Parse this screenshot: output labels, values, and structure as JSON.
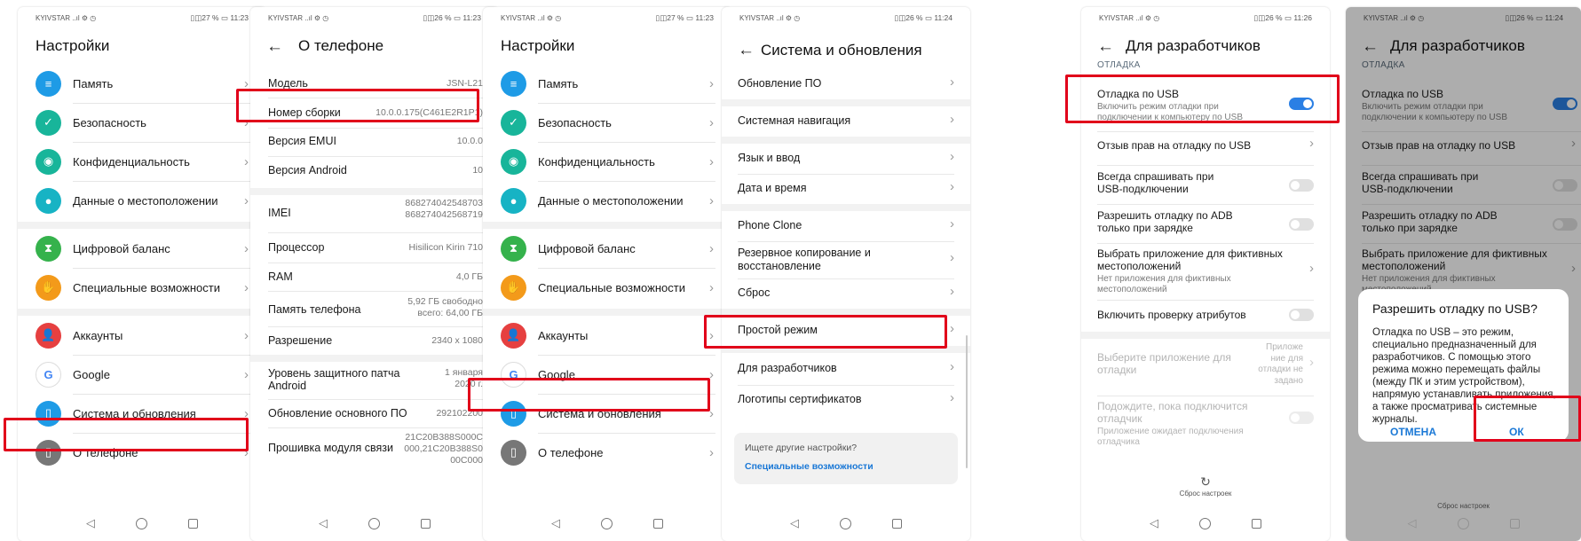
{
  "status": {
    "p1": {
      "carrier": "KYIVSTAR ..ıl ⚙ ◷",
      "right": "▯◫27 % ▭ 11:23"
    },
    "p2": {
      "carrier": "KYIVSTAR ..ıl ⚙ ◷",
      "right": "▯◫26 % ▭ 11:23"
    },
    "p3": {
      "carrier": "KYIVSTAR ..ıl ⚙ ◷",
      "right": "▯◫27 % ▭ 11:23"
    },
    "p4": {
      "carrier": "KYIVSTAR ..ıl ⚙ ◷",
      "right": "▯◫26 % ▭ 11:24"
    },
    "p5": {
      "carrier": "KYIVSTAR ..ıl ⚙ ◷",
      "right": "▯◫26 % ▭ 11:26"
    },
    "p6": {
      "carrier": "KYIVSTAR ..ıl ⚙ ◷",
      "right": "▯◫26 % ▭ 11:24"
    }
  },
  "settings": {
    "title": "Настройки",
    "items": [
      {
        "label": "Память",
        "icon": "storage-icon",
        "color": "#1e9be6"
      },
      {
        "label": "Безопасность",
        "icon": "shield-icon",
        "color": "#18b59a"
      },
      {
        "label": "Конфиденциальность",
        "icon": "privacy-icon",
        "color": "#18b59a"
      },
      {
        "label": "Данные о местоположении",
        "icon": "location-icon",
        "color": "#17b3c4"
      },
      {
        "label": "Цифровой баланс",
        "icon": "hourglass-icon",
        "color": "#35b24c"
      },
      {
        "label": "Специальные возможности",
        "icon": "hand-icon",
        "color": "#f39a1a"
      },
      {
        "label": "Аккаунты",
        "icon": "account-icon",
        "color": "#e64040"
      },
      {
        "label": "Google",
        "icon": "google-icon",
        "color": "#ffffff"
      },
      {
        "label": "Система и обновления",
        "icon": "phone-update-icon",
        "color": "#1e9be6"
      },
      {
        "label": "О телефоне",
        "icon": "phone-info-icon",
        "color": "#777777"
      }
    ]
  },
  "about": {
    "title": "О телефоне",
    "rows": [
      {
        "k": "Модель",
        "v": "JSN-L21"
      },
      {
        "k": "Номер сборки",
        "v": "10.0.0.175(C461E2R1P1)"
      },
      {
        "k": "Версия EMUI",
        "v": "10.0.0"
      },
      {
        "k": "Версия Android",
        "v": "10"
      },
      {
        "k": "IMEI",
        "v1": "868274042548703",
        "v2": "868274042568719"
      },
      {
        "k": "Процессор",
        "v": "Hisilicon Kirin 710"
      },
      {
        "k": "RAM",
        "v": "4,0  ГБ"
      },
      {
        "k": "Память телефона",
        "v1": "5,92  ГБ свободно",
        "v2": "всего: 64,00  ГБ"
      },
      {
        "k": "Разрешение",
        "v": "2340 x 1080"
      },
      {
        "k1": "Уровень защитного патча",
        "k2": "Android",
        "v1": "1 января",
        "v2": "2020 г."
      },
      {
        "k": "Обновление основного ПО",
        "v": "292102200"
      },
      {
        "k": "Прошивка модуля связи",
        "v1": "21C20B388S000C",
        "v2": "000,21C20B388S0",
        "v3": "00C000"
      }
    ]
  },
  "system": {
    "title": "Система и обновления",
    "items": [
      "Обновление ПО",
      "Системная навигация",
      "Язык и ввод",
      "Дата и время",
      "Phone Clone",
      "Резервное копирование и",
      "восстановление",
      "Сброс",
      "Простой режим",
      "Для разработчиков",
      "Логотипы сертификатов"
    ],
    "hint_q": "Ищете другие настройки?",
    "hint_link": "Специальные возможности"
  },
  "dev": {
    "title": "Для разработчиков",
    "section": "ОТЛАДКА",
    "usb_title": "Отладка по USB",
    "usb_sub1": "Включить режим отладки при",
    "usb_sub2": "подключении к компьютеру по USB",
    "revoke": "Отзыв прав на отладку по USB",
    "ask1": "Всегда спрашивать при",
    "ask2": "USB-подключении",
    "adb1": "Разрешить отладку по ADB",
    "adb2": "только при зарядке",
    "mock1": "Выбрать приложение для фиктивных",
    "mock2": "местоположений",
    "mock_s1": "Нет приложения для фиктивных",
    "mock_s2": "местоположений",
    "attr": "Включить проверку атрибутов",
    "debugapp1": "Выберите приложение для",
    "debugapp2": "отладки",
    "debugapp_v1": "Приложе",
    "debugapp_v2": "ние для",
    "debugapp_v3": "отладки не",
    "debugapp_v4": "задано",
    "wait1": "Подождите, пока подключится",
    "wait2": "отладчик",
    "wait_s1": "Приложение ожидает подключения",
    "wait_s2": "отладчика",
    "reset": "Сброс настроек"
  },
  "dialog": {
    "title": "Разрешить отладку по USB?",
    "body": "Отладка по USB – это режим, специально предназначенный для разработчиков. С помощью этого режима можно перемещать файлы (между ПК и этим устройством), напрямую устанавливать приложения, а также просматривать системные журналы.",
    "cancel": "ОТМЕНА",
    "ok": "ОК",
    "reset_under": "Сброс настроек"
  },
  "colors": {
    "accent": "#2a7fe4",
    "highlight": "#e1001a",
    "link": "#1a78d6"
  }
}
